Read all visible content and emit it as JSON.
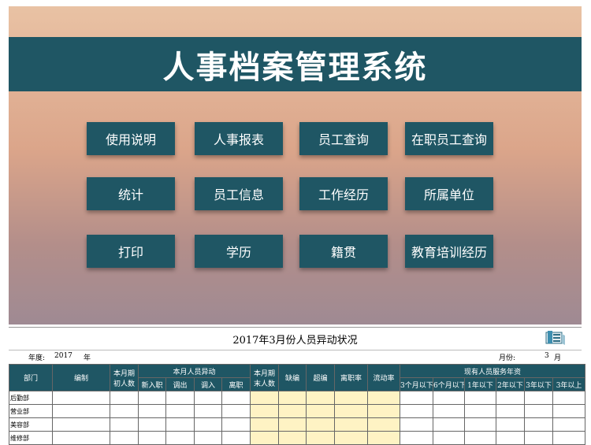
{
  "header": {
    "title": "人事档案管理系统"
  },
  "menu": [
    {
      "id": "usage",
      "label": "使用说明"
    },
    {
      "id": "hr-report",
      "label": "人事报表"
    },
    {
      "id": "staff-query",
      "label": "员工查询"
    },
    {
      "id": "active-staff-query",
      "label": "在职员工查询"
    },
    {
      "id": "statistics",
      "label": "统计"
    },
    {
      "id": "staff-info",
      "label": "员工信息"
    },
    {
      "id": "work-history",
      "label": "工作经历"
    },
    {
      "id": "unit",
      "label": "所属单位"
    },
    {
      "id": "print",
      "label": "打印"
    },
    {
      "id": "education",
      "label": "学历"
    },
    {
      "id": "native-place",
      "label": "籍贯"
    },
    {
      "id": "training",
      "label": "教育培训经历"
    }
  ],
  "sheet": {
    "title": "2017年3月份人员异动状况",
    "year_label": "年度:",
    "year_value": "2017",
    "year_unit": "年",
    "month_label": "月份:",
    "month_value": "3",
    "month_unit": "月",
    "headers": {
      "dept": "部门",
      "staffing": "编制",
      "begin_count_1": "本月期",
      "begin_count_2": "初人数",
      "change_group": "本月人员异动",
      "new_hire": "新入职",
      "transfer_out": "调出",
      "transfer_in": "调入",
      "resign": "离职",
      "end_count_1": "本月期",
      "end_count_2": "末人数",
      "shortage": "缺编",
      "overstaff": "超编",
      "turnover_rate": "离职率",
      "flow_rate": "流动率",
      "tenure_group": "现有人员服务年资",
      "t1": "3个月以下",
      "t2": "6个月以下",
      "t3": "1年以下",
      "t4": "2年以下",
      "t5": "3年以下",
      "t6": "3年以上"
    },
    "rows": [
      "后勤部",
      "营业部",
      "美容部",
      "维修部"
    ]
  }
}
